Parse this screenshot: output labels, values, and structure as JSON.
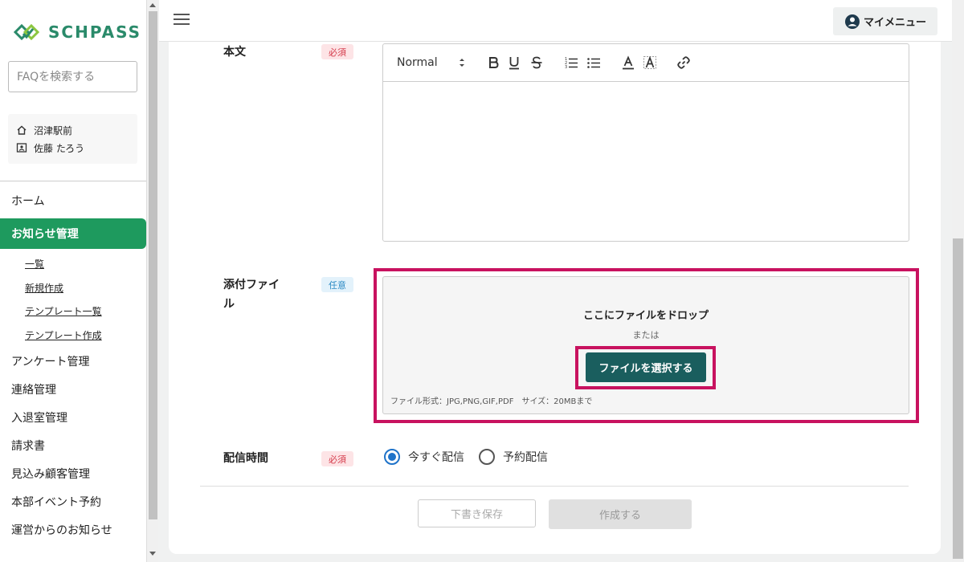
{
  "app": {
    "logo_text": "SCHPASS"
  },
  "sidebar": {
    "search_placeholder": "FAQを検索する",
    "user": {
      "location": "沼津駅前",
      "name": "佐藤 たろう"
    },
    "nav": [
      {
        "label": "ホーム"
      },
      {
        "label": "お知らせ管理"
      },
      {
        "label": "アンケート管理"
      },
      {
        "label": "連絡管理"
      },
      {
        "label": "入退室管理"
      },
      {
        "label": "請求書"
      },
      {
        "label": "見込み顧客管理"
      },
      {
        "label": "本部イベント予約"
      },
      {
        "label": "運営からのお知らせ"
      }
    ],
    "sub_nav": [
      {
        "label": "一覧"
      },
      {
        "label": "新規作成"
      },
      {
        "label": "テンプレート一覧"
      },
      {
        "label": "テンプレート作成"
      }
    ]
  },
  "header": {
    "mymenu_label": "マイメニュー"
  },
  "form": {
    "body": {
      "label": "本文",
      "badge": "必須"
    },
    "editor": {
      "format": "Normal"
    },
    "attachment": {
      "label": "添付ファイル",
      "badge": "任意",
      "drop_text": "ここにファイルをドロップ",
      "or_text": "または",
      "select_button": "ファイルを選択する",
      "note": "ファイル形式：JPG,PNG,GIF,PDF　サイズ：20MBまで"
    },
    "delivery": {
      "label": "配信時間",
      "badge": "必須",
      "options": [
        {
          "label": "今すぐ配信",
          "checked": true
        },
        {
          "label": "予約配信",
          "checked": false
        }
      ]
    },
    "buttons": {
      "draft": "下書き保存",
      "create": "作成する"
    }
  },
  "colors": {
    "brand": "#1e9a5e",
    "highlight": "#c8125f",
    "primary_button": "#1a5e5e",
    "radio": "#1f73c9"
  }
}
